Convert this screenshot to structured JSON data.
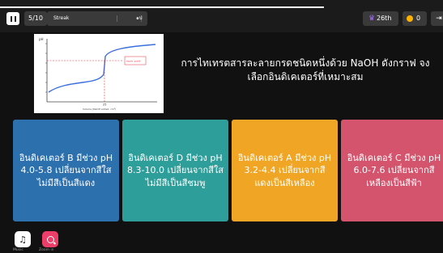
{
  "topbar": {
    "question_counter": "5/10",
    "streak_label": "Streak",
    "sound_indicator": "๑ป",
    "rank": "26th",
    "coins": "0",
    "exit_label": "⇥"
  },
  "graph": {
    "y_label": "pH",
    "x_label": "Volume (NaOH added, cm³)",
    "mark_label": "25",
    "annotation": "equiv. point"
  },
  "question": {
    "text": "การไทเทรตสารละลายกรดชนิดหนึ่งด้วย NaOH ดังกราฟ จงเลือกอินดิเคเตอร์ที่เหมาะสม"
  },
  "options": [
    {
      "label": "อินดิเคเตอร์ B มีช่วง pH 4.0-5.8 เปลี่ยนจากสีใสไม่มีสีเป็นสีแดง",
      "color": "#2d70ae"
    },
    {
      "label": "อินดิเคเตอร์ D มีช่วง pH 8.3-10.0 เปลี่ยนจากสีใสไม่มีสีเป็นสีชมพู",
      "color": "#2d9e99"
    },
    {
      "label": "อินดิเคเตอร์ A มีช่วง pH 3.2-4.4 เปลี่ยนจากสีแดงเป็นสีเหลือง",
      "color": "#f0a624"
    },
    {
      "label": "อินดิเคเตอร์ C มีช่วง pH 6.0-7.6 เปลี่ยนจากสีเหลืองเป็นสีฟ้า",
      "color": "#d5546d"
    }
  ],
  "footer": {
    "music_label": "Music",
    "zoom_label": "Zoom in"
  },
  "colors": {
    "background": "#111111",
    "rank_icon": "#a36bff",
    "coin": "#ffb300",
    "zoom_button": "#ec3e69",
    "curve": "#3b6fe0",
    "marker": "#e0313b"
  }
}
